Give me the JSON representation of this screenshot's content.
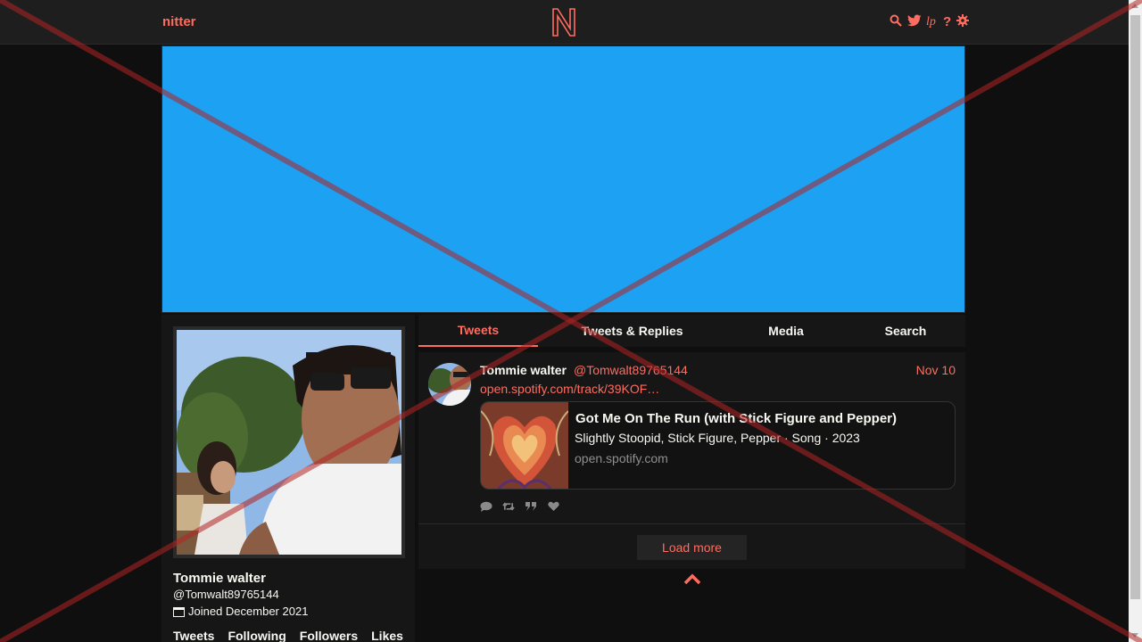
{
  "nav": {
    "brand": "nitter",
    "logo_letter": "N",
    "icons": [
      "search-icon",
      "twitter-icon",
      "rss-icon",
      "help-icon",
      "gear-icon"
    ]
  },
  "colors": {
    "accent": "#ff6c60",
    "banner": "#1da1f2",
    "background": "#0f0f0f",
    "card_bg": "#161616",
    "overlay_x": "#b22222"
  },
  "profile": {
    "name": "Tommie walter",
    "handle": "@Tomwalt89765144",
    "joined": "Joined December 2021",
    "stats": [
      "Tweets",
      "Following",
      "Followers",
      "Likes"
    ]
  },
  "tabs": [
    "Tweets",
    "Tweets & Replies",
    "Media",
    "Search"
  ],
  "tweet": {
    "fullname": "Tommie walter",
    "username": "@Tomwalt89765144",
    "date": "Nov 10",
    "link": "open.spotify.com/track/39KOF…",
    "card": {
      "title": "Got Me On The Run (with Stick Figure and Pepper)",
      "description": "Slightly Stoopid, Stick Figure, Pepper · Song · 2023",
      "destination": "open.spotify.com"
    },
    "actions": [
      "comment-icon",
      "retweet-icon",
      "quote-icon",
      "heart-icon"
    ]
  },
  "timeline": {
    "load_more": "Load more"
  }
}
